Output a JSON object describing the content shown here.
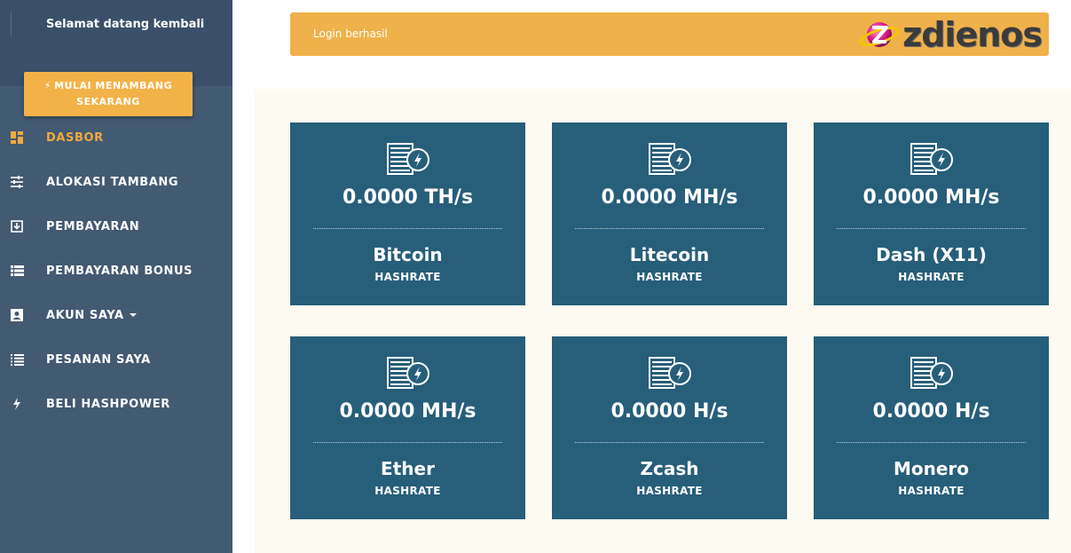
{
  "sidebar": {
    "welcome": "Selamat datang kembali",
    "mine_button": {
      "icon": "bolt-icon",
      "line1": "MULAI MENAMBANG",
      "line2": "SEKARANG"
    },
    "items": [
      {
        "label": "DASBOR",
        "icon": "dashboard-icon",
        "active": true
      },
      {
        "label": "ALOKASI TAMBANG",
        "icon": "sliders-icon"
      },
      {
        "label": "PEMBAYARAN",
        "icon": "download-icon"
      },
      {
        "label": "PEMBAYARAN BONUS",
        "icon": "list-icon"
      },
      {
        "label": "AKUN SAYA",
        "icon": "account-icon",
        "has_dropdown": true
      },
      {
        "label": "PESANAN SAYA",
        "icon": "ordered-list-icon"
      },
      {
        "label": "BELI HASHPOWER",
        "icon": "bolt-icon"
      }
    ]
  },
  "alert": {
    "message": "Login berhasil",
    "logo_text": "zdienos"
  },
  "cards": [
    {
      "rate": "0.0000 TH/s",
      "coin": "Bitcoin",
      "label": "HASHRATE"
    },
    {
      "rate": "0.0000 MH/s",
      "coin": "Litecoin",
      "label": "HASHRATE"
    },
    {
      "rate": "0.0000 MH/s",
      "coin": "Dash (X11)",
      "label": "HASHRATE"
    },
    {
      "rate": "0.0000 MH/s",
      "coin": "Ether",
      "label": "HASHRATE"
    },
    {
      "rate": "0.0000 H/s",
      "coin": "Zcash",
      "label": "HASHRATE"
    },
    {
      "rate": "0.0000 H/s",
      "coin": "Monero",
      "label": "HASHRATE"
    }
  ],
  "colors": {
    "sidebar": "#435a73",
    "accent": "#f3b248",
    "card": "#275e7a",
    "panel": "#fdfaf2"
  }
}
